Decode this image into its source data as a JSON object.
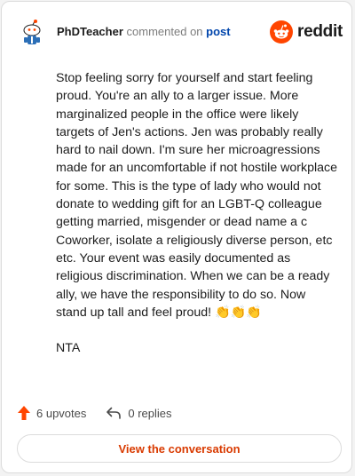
{
  "comment": {
    "username": "PhDTeacher",
    "verb": "commented on",
    "post_link": "post",
    "brand": "reddit",
    "paragraphs": [
      "Stop feeling sorry for yourself and start feeling proud. You're an ally to a larger issue. More marginalized people in the office were likely targets of Jen's actions. Jen was probably really hard to nail down. I'm sure her microagressions made for an uncomfortable if not hostile workplace for some. This is the type of lady who would not donate to wedding gift for an LGBT-Q colleague getting married, misgender or dead name a c Coworker, isolate a religiously diverse person, etc etc. Your event was easily documented as religious discrimination. When we can be a ready ally, we have the responsibility to do so. Now stand up tall and feel proud! 👏👏👏",
      "NTA"
    ]
  },
  "footer": {
    "upvotes": "6 upvotes",
    "replies": "0 replies"
  },
  "cta": {
    "label": "View the conversation"
  },
  "colors": {
    "brand": "#ff4500",
    "link": "#0045ac",
    "cta_text": "#d93a00"
  },
  "icons": [
    "snoo-avatar",
    "reddit-logo-icon",
    "upvote-arrow-icon",
    "reply-icon"
  ]
}
